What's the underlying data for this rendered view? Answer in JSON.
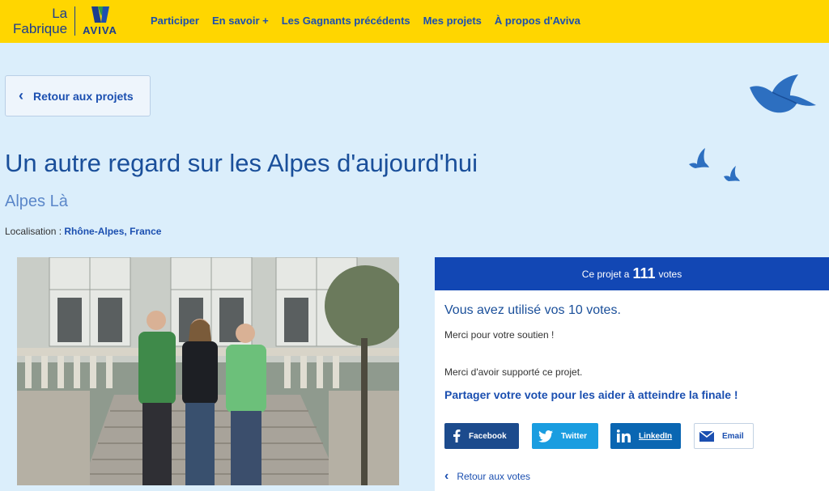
{
  "brand": {
    "line1": "La",
    "line2": "Fabrique",
    "aviva": "AVIVA"
  },
  "nav": [
    "Participer",
    "En savoir +",
    "Les Gagnants précédents",
    "Mes projets",
    "À propos d'Aviva"
  ],
  "back_label": "Retour aux projets",
  "project": {
    "title": "Un autre regard sur les Alpes d'aujourd'hui",
    "team": "Alpes Là",
    "location_label": "Localisation :",
    "location_value": "Rhône-Alpes, France"
  },
  "votes": {
    "prefix": "Ce projet a",
    "count": "111",
    "suffix": "votes",
    "used": "Vous avez utilisé vos 10 votes.",
    "thanks": "Merci pour votre soutien !",
    "supported": "Merci d'avoir supporté ce projet.",
    "share_prompt": "Partager votre vote pour les aider à atteindre la finale !",
    "back_votes": "Retour aux votes"
  },
  "share": {
    "facebook": "Facebook",
    "twitter": "Twitter",
    "linkedin": "LinkedIn",
    "email": "Email"
  },
  "colors": {
    "header": "#ffd600",
    "accent": "#1247b4",
    "background": "#dbeefb"
  }
}
